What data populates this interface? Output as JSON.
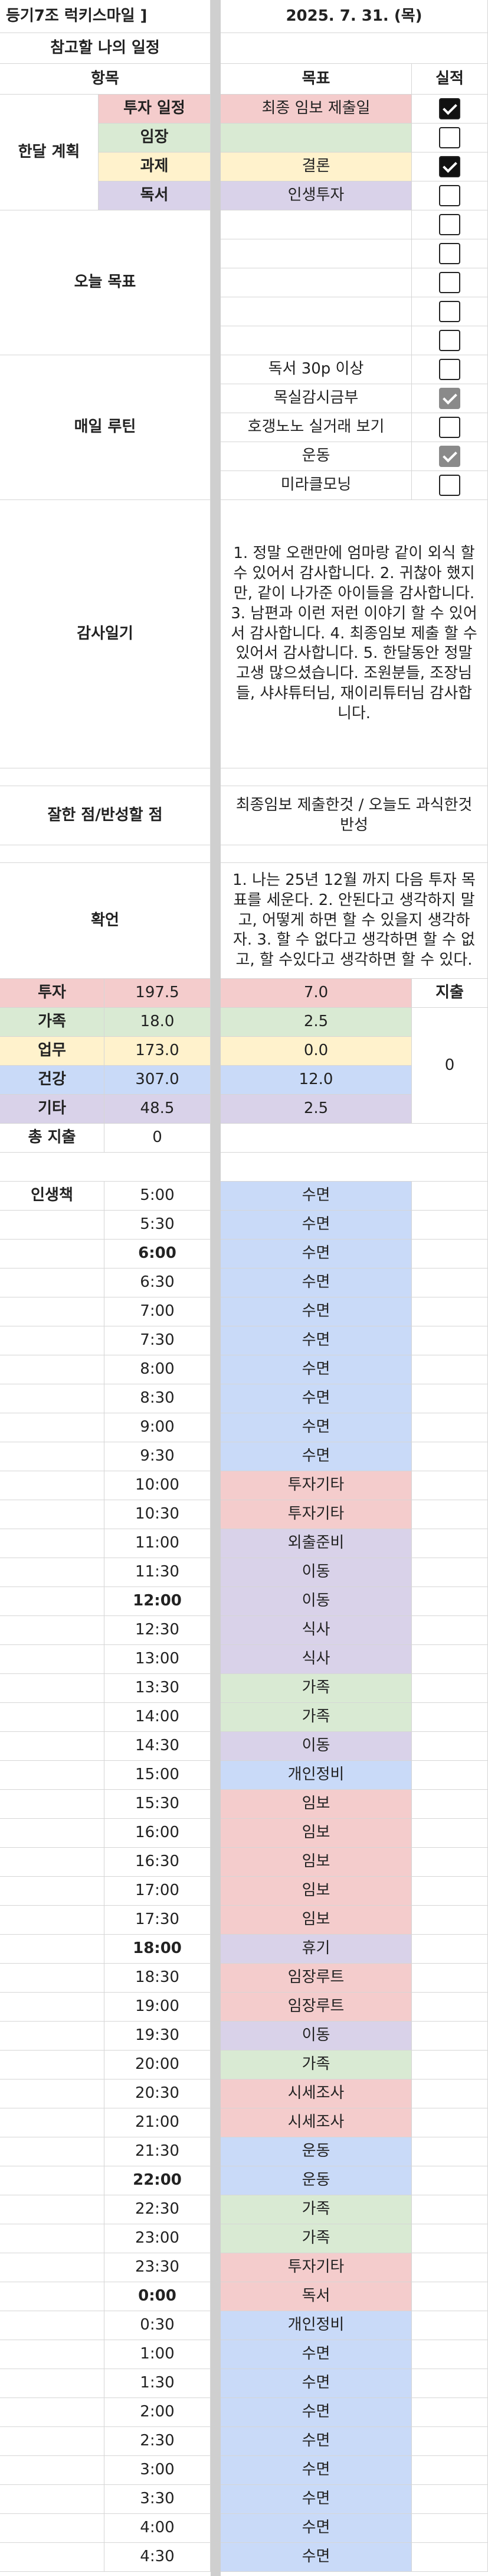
{
  "header": {
    "title": "등기7조 럭키스마일 ]",
    "date": "2025. 7. 31. (목)"
  },
  "plan": {
    "section_title": "참고할 나의 일정",
    "col_item": "항목",
    "col_goal": "목표",
    "col_done": "실적",
    "group_label": "한달 계획",
    "rows": [
      {
        "item": "투자 일정",
        "goal": "최종 임보 제출일",
        "checked": true
      },
      {
        "item": "임장",
        "goal": "",
        "checked": false
      },
      {
        "item": "과제",
        "goal": "결론",
        "checked": true
      },
      {
        "item": "독서",
        "goal": "인생투자",
        "checked": false
      }
    ]
  },
  "today": {
    "label": "오늘 목표",
    "rows": [
      false,
      false,
      false,
      false,
      false
    ]
  },
  "routine": {
    "label": "매일 루틴",
    "rows": [
      {
        "goal": "독서 30p 이상",
        "checked": false
      },
      {
        "goal": "목실감시금부",
        "checked": true
      },
      {
        "goal": "호갱노노 실거래 보기",
        "checked": false
      },
      {
        "goal": "운동",
        "checked": true
      },
      {
        "goal": "미라클모닝",
        "checked": false
      }
    ]
  },
  "gratitude": {
    "label": "감사일기",
    "text": "1. 정말 오랜만에 엄마랑 같이 외식 할 수 있어서 감사합니다. 2. 귀찮아 했지만, 같이 나가준 아이들을 감사합니다. 3. 남편과 이런 저런 이야기 할 수 있어서 감사합니다.  4. 최종임보 제출 할 수 있어서 감사합니다.  5. 한달동안 정말 고생 많으셨습니다. 조원분들, 조장님들, 샤샤튜터님, 재이리튜터님 감사합니다."
  },
  "review": {
    "label": "잘한 점/반성할 점",
    "text": "최종임보 제출한것  /  오늘도 과식한것 반성"
  },
  "confirm": {
    "label": "확언",
    "text": "1. 나는 25년 12월 까지 다음 투자 목표를 세운다. 2. 안된다고 생각하지 말고, 어떻게 하면 할 수 있을지 생각하자. 3. 할 수 없다고 생각하면 할 수 없고, 할 수있다고 생각하면 할 수 있다."
  },
  "stats": {
    "rows": [
      {
        "name": "투자",
        "total": "197.5",
        "today": "7.0",
        "color": "#f4cccc"
      },
      {
        "name": "가족",
        "total": "18.0",
        "today": "2.5",
        "color": "#d9ead3"
      },
      {
        "name": "업무",
        "total": "173.0",
        "today": "0.0",
        "color": "#fff2cc"
      },
      {
        "name": "건강",
        "total": "307.0",
        "today": "12.0",
        "color": "#c9daf8"
      },
      {
        "name": "기타",
        "total": "48.5",
        "today": "2.5",
        "color": "#d9d2e9"
      }
    ],
    "expense_label": "지출",
    "expense_value": "0",
    "total_expense_label": "총 지출",
    "total_expense_value": "0"
  },
  "schedule": {
    "label": "인생책",
    "colors": {
      "investment": "#f4cccc",
      "family": "#d9ead3",
      "work": "#fff2cc",
      "health": "#c9daf8",
      "other": "#d9d2e9"
    },
    "rows": [
      {
        "time": "5:00",
        "task": "수면",
        "cat": "health",
        "bold": false
      },
      {
        "time": "5:30",
        "task": "수면",
        "cat": "health",
        "bold": false
      },
      {
        "time": "6:00",
        "task": "수면",
        "cat": "health",
        "bold": true
      },
      {
        "time": "6:30",
        "task": "수면",
        "cat": "health",
        "bold": false
      },
      {
        "time": "7:00",
        "task": "수면",
        "cat": "health",
        "bold": false
      },
      {
        "time": "7:30",
        "task": "수면",
        "cat": "health",
        "bold": false
      },
      {
        "time": "8:00",
        "task": "수면",
        "cat": "health",
        "bold": false
      },
      {
        "time": "8:30",
        "task": "수면",
        "cat": "health",
        "bold": false
      },
      {
        "time": "9:00",
        "task": "수면",
        "cat": "health",
        "bold": false
      },
      {
        "time": "9:30",
        "task": "수면",
        "cat": "health",
        "bold": false
      },
      {
        "time": "10:00",
        "task": "투자기타",
        "cat": "investment",
        "bold": false
      },
      {
        "time": "10:30",
        "task": "투자기타",
        "cat": "investment",
        "bold": false
      },
      {
        "time": "11:00",
        "task": "외출준비",
        "cat": "other",
        "bold": false
      },
      {
        "time": "11:30",
        "task": "이동",
        "cat": "other",
        "bold": false
      },
      {
        "time": "12:00",
        "task": "이동",
        "cat": "other",
        "bold": true
      },
      {
        "time": "12:30",
        "task": "식사",
        "cat": "other",
        "bold": false
      },
      {
        "time": "13:00",
        "task": "식사",
        "cat": "other",
        "bold": false
      },
      {
        "time": "13:30",
        "task": "가족",
        "cat": "family",
        "bold": false
      },
      {
        "time": "14:00",
        "task": "가족",
        "cat": "family",
        "bold": false
      },
      {
        "time": "14:30",
        "task": "이동",
        "cat": "other",
        "bold": false
      },
      {
        "time": "15:00",
        "task": "개인정비",
        "cat": "health",
        "bold": false
      },
      {
        "time": "15:30",
        "task": "임보",
        "cat": "investment",
        "bold": false
      },
      {
        "time": "16:00",
        "task": "임보",
        "cat": "investment",
        "bold": false
      },
      {
        "time": "16:30",
        "task": "임보",
        "cat": "investment",
        "bold": false
      },
      {
        "time": "17:00",
        "task": "임보",
        "cat": "investment",
        "bold": false
      },
      {
        "time": "17:30",
        "task": "임보",
        "cat": "investment",
        "bold": false
      },
      {
        "time": "18:00",
        "task": "휴기",
        "cat": "other",
        "bold": true
      },
      {
        "time": "18:30",
        "task": "임장루트",
        "cat": "investment",
        "bold": false
      },
      {
        "time": "19:00",
        "task": "임장루트",
        "cat": "investment",
        "bold": false
      },
      {
        "time": "19:30",
        "task": "이동",
        "cat": "other",
        "bold": false
      },
      {
        "time": "20:00",
        "task": "가족",
        "cat": "family",
        "bold": false
      },
      {
        "time": "20:30",
        "task": "시세조사",
        "cat": "investment",
        "bold": false
      },
      {
        "time": "21:00",
        "task": "시세조사",
        "cat": "investment",
        "bold": false
      },
      {
        "time": "21:30",
        "task": "운동",
        "cat": "health",
        "bold": false
      },
      {
        "time": "22:00",
        "task": "운동",
        "cat": "health",
        "bold": true
      },
      {
        "time": "22:30",
        "task": "가족",
        "cat": "family",
        "bold": false
      },
      {
        "time": "23:00",
        "task": "가족",
        "cat": "family",
        "bold": false
      },
      {
        "time": "23:30",
        "task": "투자기타",
        "cat": "investment",
        "bold": false
      },
      {
        "time": "0:00",
        "task": "독서",
        "cat": "investment",
        "bold": true
      },
      {
        "time": "0:30",
        "task": "개인정비",
        "cat": "health",
        "bold": false
      },
      {
        "time": "1:00",
        "task": "수면",
        "cat": "health",
        "bold": false
      },
      {
        "time": "1:30",
        "task": "수면",
        "cat": "health",
        "bold": false
      },
      {
        "time": "2:00",
        "task": "수면",
        "cat": "health",
        "bold": false
      },
      {
        "time": "2:30",
        "task": "수면",
        "cat": "health",
        "bold": false
      },
      {
        "time": "3:00",
        "task": "수면",
        "cat": "health",
        "bold": false
      },
      {
        "time": "3:30",
        "task": "수면",
        "cat": "health",
        "bold": false
      },
      {
        "time": "4:00",
        "task": "수면",
        "cat": "health",
        "bold": false
      },
      {
        "time": "4:30",
        "task": "수면",
        "cat": "health",
        "bold": false
      }
    ]
  }
}
